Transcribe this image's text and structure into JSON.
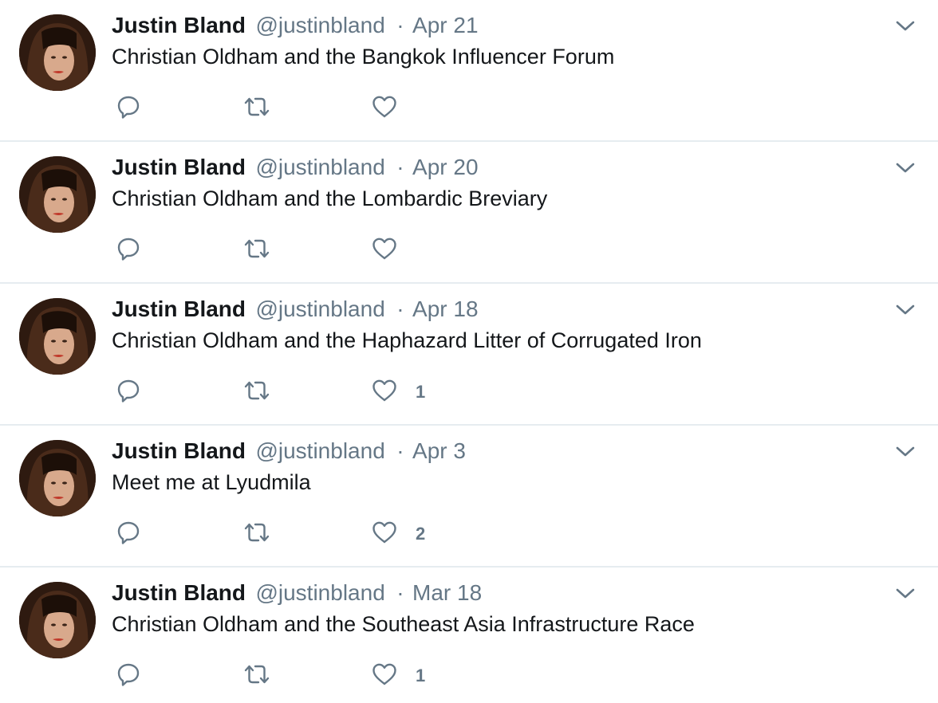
{
  "tweets": [
    {
      "name": "Justin Bland",
      "handle": "@justinbland",
      "separator": "·",
      "date": "Apr 21",
      "text": "Christian Oldham and the Bangkok Influencer Forum",
      "like_count": ""
    },
    {
      "name": "Justin Bland",
      "handle": "@justinbland",
      "separator": "·",
      "date": "Apr 20",
      "text": "Christian Oldham and the Lombardic Breviary",
      "like_count": ""
    },
    {
      "name": "Justin Bland",
      "handle": "@justinbland",
      "separator": "·",
      "date": "Apr 18",
      "text": "Christian Oldham and the Haphazard Litter of Corrugated Iron",
      "like_count": "1"
    },
    {
      "name": "Justin Bland",
      "handle": "@justinbland",
      "separator": "·",
      "date": "Apr 3",
      "text": "Meet me at Lyudmila",
      "like_count": "2"
    },
    {
      "name": "Justin Bland",
      "handle": "@justinbland",
      "separator": "·",
      "date": "Mar 18",
      "text": "Christian Oldham and the Southeast Asia Infrastructure Race",
      "like_count": "1"
    }
  ],
  "icons": {
    "reply": "reply-icon",
    "retweet": "retweet-icon",
    "like": "heart-icon",
    "menu": "chevron-down-icon"
  },
  "colors": {
    "text": "#14171a",
    "secondary": "#657786",
    "divider": "#e6ecf0"
  }
}
